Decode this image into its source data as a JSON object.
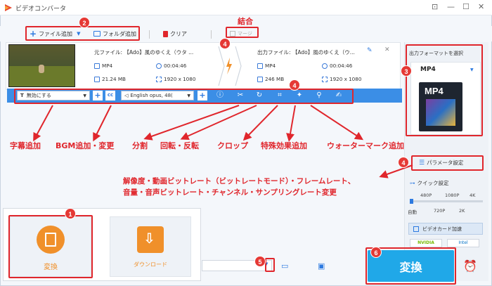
{
  "app": {
    "title": "ビデオコンバータ"
  },
  "window": {
    "pin": "⊡",
    "minimize": "—",
    "maximize": "☐",
    "close": "✕"
  },
  "toolbar": {
    "add_file": "ファイル追加",
    "add_folder": "フォルダ追加",
    "clear": "クリア",
    "merge": "マージ"
  },
  "file": {
    "source_label": "元ファイル: 【Ado】風のゆくえ（ウタ ...",
    "source_format": "MP4",
    "source_duration": "00:04:46",
    "source_size": "21.24 MB",
    "source_resolution": "1920 x 1080",
    "output_label": "出力ファイル: 【Ado】風のゆくえ（ウ...",
    "output_format": "MP4",
    "output_duration": "00:04:46",
    "output_size": "246 MB",
    "output_resolution": "1920 x 1080"
  },
  "subbar": {
    "subtitle_select": "無効にする",
    "audio_select": "English opus, 48("
  },
  "right_panel": {
    "format_title": "出力フォーマットを選択",
    "format_value": "MP4",
    "format_badge": "MP4",
    "param_button": "パラメータ設定",
    "quick_title": "クイック設定",
    "scale_top": [
      "480P",
      "1080P",
      "4K"
    ],
    "scale_bottom": [
      "自動",
      "720P",
      "2K"
    ],
    "gpu_label": "ビデオカード加速",
    "nvidia": "NVIDIA",
    "intel": "Intel"
  },
  "bottom": {
    "convert_tab": "変換",
    "download_tab": "ダウンロード",
    "convert_button": "変換"
  },
  "annotations": {
    "merge_note": "結合",
    "subtitle": "字幕追加",
    "bgm": "BGM追加・変更",
    "split": "分割",
    "rotate": "回転・反転",
    "crop": "クロップ",
    "effects": "特殊効果追加",
    "watermark": "ウォーターマーク追加",
    "param_line1": "解像度・動画ビットレート（ビットレートモード）・フレームレート、",
    "param_line2": "音量・音声ビットレート・チャンネル・サンプリングレート変更",
    "badges": [
      "1",
      "2",
      "3",
      "4",
      "4",
      "4",
      "5",
      "6"
    ]
  },
  "colors": {
    "accent": "#3b8ee6",
    "annotation": "#e0262c",
    "convert": "#20a8e8",
    "orange": "#f0902a"
  }
}
